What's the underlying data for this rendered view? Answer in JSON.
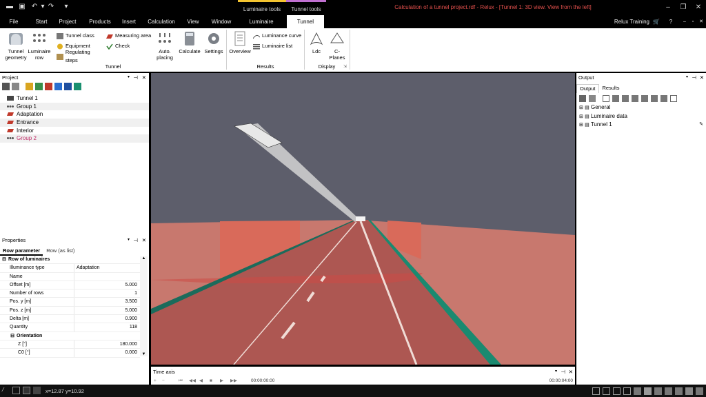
{
  "window": {
    "title": "Calculation of a tunnel project.rdf - Relux - [Tunnel 1: 3D view. View from the left]",
    "context_tabs": [
      "Luminaire tools",
      "Tunnel tools"
    ]
  },
  "menu": {
    "items": [
      "File",
      "Start",
      "Project",
      "Products",
      "Insert",
      "Calculation",
      "View",
      "Window",
      "Luminaire",
      "Tunnel"
    ],
    "user": "Relux Training"
  },
  "ribbon": {
    "tunnel_geometry": "Tunnel geometry",
    "luminaire_row": "Luminaire row",
    "tunnel_class": "Tunnel class",
    "equipment": "Equipment",
    "regulating_steps": "Regulating steps",
    "measuring_area": "Measuring area",
    "check": "Check",
    "auto_placing": "Auto. placing",
    "calculate": "Calculate",
    "settings": "Settings",
    "overview": "Overview",
    "luminance_curve": "Luminance curve",
    "luminaire_list": "Luminaire list",
    "ldc": "Ldc",
    "c_planes": "C-Planes",
    "groups": {
      "tunnel": "Tunnel",
      "results": "Results",
      "display": "Display"
    }
  },
  "project": {
    "title": "Project",
    "items": [
      "Tunnel 1",
      "Group  1",
      "Adaptation",
      "Entrance",
      "Interior",
      "Group  2"
    ]
  },
  "properties": {
    "title": "Properties",
    "tabs": [
      "Row parameter",
      "Row (as list)"
    ],
    "section": "Row of luminaires",
    "rows": [
      {
        "k": "Illuminance type",
        "v": "Adaptation"
      },
      {
        "k": "Name",
        "v": ""
      },
      {
        "k": "Offset [m]",
        "v": "5.000"
      },
      {
        "k": "Number of rows",
        "v": "1"
      },
      {
        "k": "Pos. y  [m]",
        "v": "3.500"
      },
      {
        "k": "Pos. z [m]",
        "v": "5.000"
      },
      {
        "k": "Delta [m]",
        "v": "0.900"
      },
      {
        "k": "Quantity",
        "v": "118"
      }
    ],
    "section2": "Orientation",
    "rows2": [
      {
        "k": "Z [°]",
        "v": "180.000"
      },
      {
        "k": "C0 [°]",
        "v": "0.000"
      }
    ]
  },
  "output": {
    "title": "Output",
    "tabs": [
      "Output",
      "Results"
    ],
    "items": [
      "General",
      "Luminaire data",
      "Tunnel 1"
    ]
  },
  "timeaxis": {
    "title": "Time axis",
    "start": "00:00:00:00",
    "end": "00:00:04:00"
  },
  "status": {
    "coords": "x=12.87 y=10.92"
  },
  "colors": {
    "accent": "#e8524e",
    "group2": "#c0306a",
    "tunnel_tab_top": "#c070d0",
    "luminaire_tab_top": "#f4c430"
  }
}
